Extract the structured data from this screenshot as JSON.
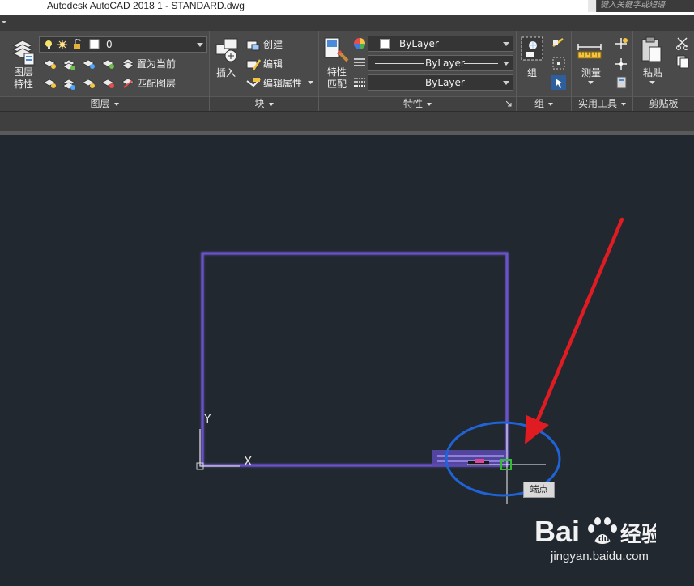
{
  "window": {
    "title": "Autodesk AutoCAD 2018     1 - STANDARD.dwg",
    "search_placeholder": "键入关键字或短语"
  },
  "ribbon": {
    "layers_panel": {
      "label": "图层",
      "layer_props_label": "图层\n特性",
      "current_layer": "0",
      "set_current_label": "置为当前",
      "match_layer_label": "匹配图层"
    },
    "block_panel": {
      "label": "块",
      "insert_label": "插入",
      "create_label": "创建",
      "edit_label": "编辑",
      "edit_attr_label": "编辑属性"
    },
    "properties_panel": {
      "label": "特性",
      "match_props_label": "特性\n匹配",
      "color_value": "ByLayer",
      "linetype_value": "ByLayer",
      "lineweight_value": "ByLayer"
    },
    "group_panel": {
      "label": "组",
      "group_label": "组"
    },
    "utilities_panel": {
      "label": "实用工具",
      "measure_label": "测量"
    },
    "clipboard_panel": {
      "label": "剪贴板",
      "paste_label": "粘贴"
    }
  },
  "canvas": {
    "ucs_y_label": "Y",
    "ucs_x_label": "X",
    "snap_tooltip": "端点",
    "colors": {
      "background": "#212830",
      "rectangle": "#6a52c8",
      "annotation_circle": "#1f63d6",
      "arrow": "#e11b22",
      "snap_marker": "#2fbf2f"
    }
  },
  "watermark": {
    "brand_text": "Bai   经验",
    "url": "jingyan.baidu.com"
  }
}
